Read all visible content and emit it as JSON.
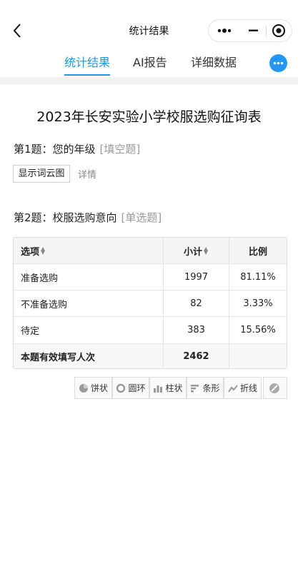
{
  "navbar": {
    "title": "统计结果"
  },
  "tabs": [
    {
      "label": "统计结果"
    },
    {
      "label": "AI报告"
    },
    {
      "label": "详细数据"
    }
  ],
  "survey": {
    "title": "2023年长安实验小学校服选购征询表"
  },
  "q1": {
    "label": "第1题：您的年级",
    "type": "[填空题]",
    "wordcloud_button": "显示词云图",
    "detail_link": "详情"
  },
  "q2": {
    "label": "第2题：校服选购意向",
    "type": "[单选题]",
    "table": {
      "headers": {
        "option": "选项",
        "count": "小计",
        "ratio": "比例"
      },
      "rows": [
        {
          "option": "准备选购",
          "count": "1997",
          "ratio": "81.11%"
        },
        {
          "option": "不准备选购",
          "count": "82",
          "ratio": "3.33%"
        },
        {
          "option": "待定",
          "count": "383",
          "ratio": "15.56%"
        }
      ],
      "footer": {
        "label": "本题有效填写人次",
        "count": "2462"
      }
    },
    "chart_buttons": [
      {
        "label": "饼状",
        "icon": "pie-chart-icon"
      },
      {
        "label": "圆环",
        "icon": "donut-chart-icon"
      },
      {
        "label": "柱状",
        "icon": "bar-chart-icon"
      },
      {
        "label": "条形",
        "icon": "horizontal-bar-icon"
      },
      {
        "label": "折线",
        "icon": "line-chart-icon"
      },
      {
        "label": "",
        "icon": "hide-chart-icon"
      }
    ]
  },
  "colors": {
    "accent": "#1e9ae0",
    "more_button": "#2196f3"
  }
}
